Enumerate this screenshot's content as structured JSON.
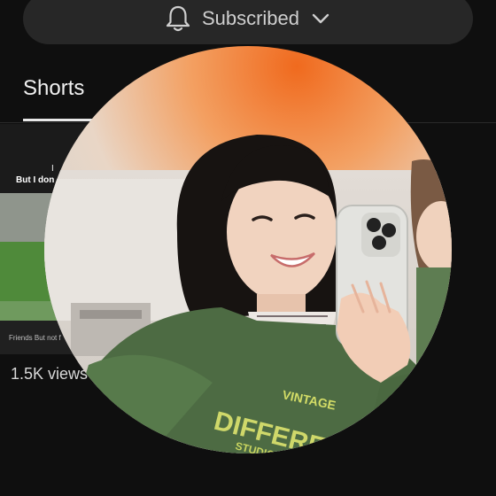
{
  "header": {
    "subscribe_label": "Subscribed"
  },
  "tabs": [
    {
      "label": "Shorts"
    }
  ],
  "short": {
    "caption_top": "I",
    "caption_main": "But I don",
    "caption_bottom": "Friends But not f",
    "views": "1.5K views"
  },
  "sweater_print": {
    "line1": "VINTAGE",
    "line2": "DIFFERENT",
    "line3": "STUDIO"
  },
  "colors": {
    "page_bg": "#0f0f0f",
    "pill_bg": "#272727",
    "text_primary": "#f1f1f1",
    "sweater": "#4d6b43",
    "print": "#d4dd67"
  }
}
